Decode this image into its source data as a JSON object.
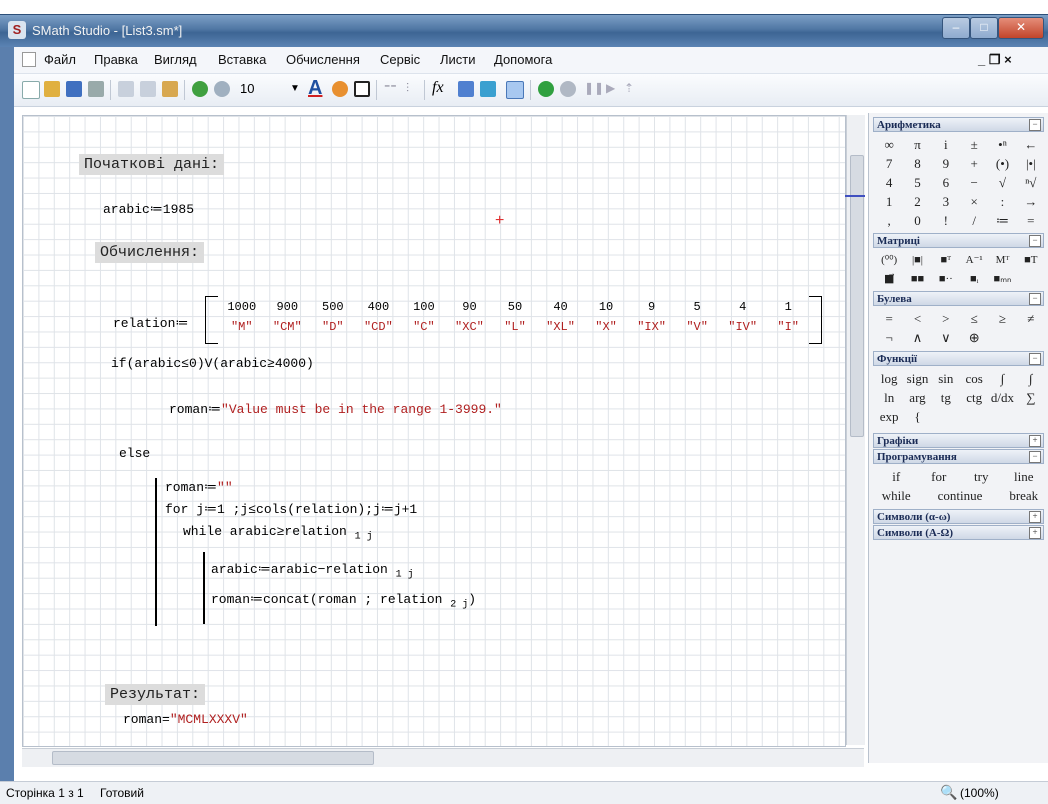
{
  "window": {
    "title": "SMath Studio - [List3.sm*]",
    "minimize": "–",
    "maximize": "□",
    "close": "✕"
  },
  "menu": [
    "Файл",
    "Правка",
    "Вигляд",
    "Вставка",
    "Обчислення",
    "Сервіс",
    "Листи",
    "Допомога"
  ],
  "menu_right": "_ ❐ ×",
  "toolbar": {
    "font_size": "10"
  },
  "sheet": {
    "heading_initial": "Початкові дані:",
    "arabic_assign": "arabic≔1985",
    "heading_calc": "Обчислення:",
    "relation_label": "relation≔",
    "relation_numbers": [
      "1000",
      "900",
      "500",
      "400",
      "100",
      "90",
      "50",
      "40",
      "10",
      "9",
      "5",
      "4",
      "1"
    ],
    "relation_letters": [
      "\"M\"",
      "\"CM\"",
      "\"D\"",
      "\"CD\"",
      "\"C\"",
      "\"XC\"",
      "\"L\"",
      "\"XL\"",
      "\"X\"",
      "\"IX\"",
      "\"V\"",
      "\"IV\"",
      "\"I\""
    ],
    "if_cond": "if(arabic≤0)V(arabic≥4000)",
    "roman_label": "roman≔",
    "roman_error": "\"Value must be in the range 1-3999.\"",
    "else_label": "else",
    "prog_line1": "roman≔",
    "prog_line1_value": "\"\"",
    "prog_line2": "for j≔1 ;j≤cols(relation);j≔j+1",
    "prog_line3": "while arabic≥relation",
    "prog_line3_sub": "1 j",
    "prog_line4": "arabic≔arabic−relation",
    "prog_line4_sub": "1 j",
    "prog_line5": "roman≔concat(roman ; relation",
    "prog_line5_sub": "2 j",
    "prog_line5_end": ")",
    "heading_result": "Результат:",
    "result_label": "roman=",
    "result_value": "\"MCMLXXXV\""
  },
  "panel": {
    "arith_title": "Арифметика",
    "arith": [
      "∞",
      "π",
      "i",
      "±",
      "•ⁿ",
      "←",
      "7",
      "8",
      "9",
      "+",
      "(•)",
      "|•|",
      "4",
      "5",
      "6",
      "−",
      "√",
      "ⁿ√",
      "1",
      "2",
      "3",
      "×",
      ":",
      "→",
      ",",
      "0",
      "!",
      "/",
      "≔",
      "="
    ],
    "matrix_title": "Матриці",
    "matrix": [
      "(⁰⁰)",
      "|■|",
      "■ᵀ",
      "A⁻¹",
      "Mᵀ",
      "■T",
      "■⃗",
      "■■",
      "■··",
      "■ᵢ",
      "■ₘₙ"
    ],
    "bool_title": "Булева",
    "bool": [
      "=",
      "<",
      ">",
      "≤",
      "≥",
      "≠",
      "¬",
      "∧",
      "∨",
      "⊕"
    ],
    "func_title": "Функції",
    "func": [
      "log",
      "sign",
      "sin",
      "cos",
      "∫",
      "∫",
      "ln",
      "arg",
      "tg",
      "ctg",
      "d/dx",
      "∑",
      "exp",
      "{"
    ],
    "graph_title": "Графіки",
    "prog_title": "Програмування",
    "prog": [
      "if",
      "for",
      "try",
      "line",
      "while",
      "continue",
      "break"
    ],
    "sym1_title": "Символи (α-ω)",
    "sym2_title": "Символи (Α-Ω)"
  },
  "status": {
    "page": "Сторінка 1 з 1",
    "state": "Готовий",
    "zoom": "(100%)"
  }
}
